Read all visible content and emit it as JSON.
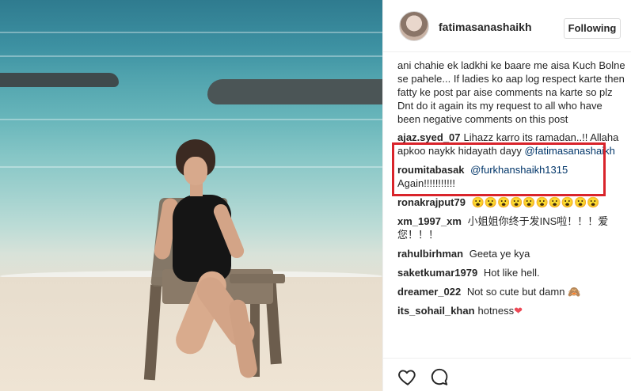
{
  "post": {
    "username": "fatimasanashaikh",
    "follow_label": "Following",
    "caption_tail": "ani chahie ek ladkhi ke baare me aisa Kuch Bolne se pahele... If ladies ko aap log respect karte then fatty ke post par aise comments na karte so plz Dnt do it again its my request to all who have been negative comments on this post"
  },
  "comments": [
    {
      "user": "ajaz.syed_07",
      "text": "Lihazz karro its ramadan..!! Allaha apkoo naykk hidayath dayy",
      "mention": "@fatimasanashaikh",
      "highlighted": true
    },
    {
      "user": "roumitabasak",
      "mention": "@furkhanshaikh1315",
      "text": "Again!!!!!!!!!!!"
    },
    {
      "user": "ronakrajput79",
      "text": "😮😮😮😮😮😮😮😮😮😮"
    },
    {
      "user": "xm_1997_xm",
      "text": "小姐姐你终于发INS啦！！！爱您！！！"
    },
    {
      "user": "rahulbirhman",
      "text": "Geeta ye kya"
    },
    {
      "user": "saketkumar1979",
      "text": "Hot like hell."
    },
    {
      "user": "dreamer_022",
      "text": "Not so cute but damn 🙈"
    },
    {
      "user": "its_sohail_khan",
      "text": "hotness",
      "emoji": "❤"
    }
  ],
  "icons": {
    "like": "heart-icon",
    "comment": "comment-bubble-icon"
  },
  "colors": {
    "highlight": "#d9242b",
    "mention": "#003569",
    "heart": "#ed4956"
  }
}
